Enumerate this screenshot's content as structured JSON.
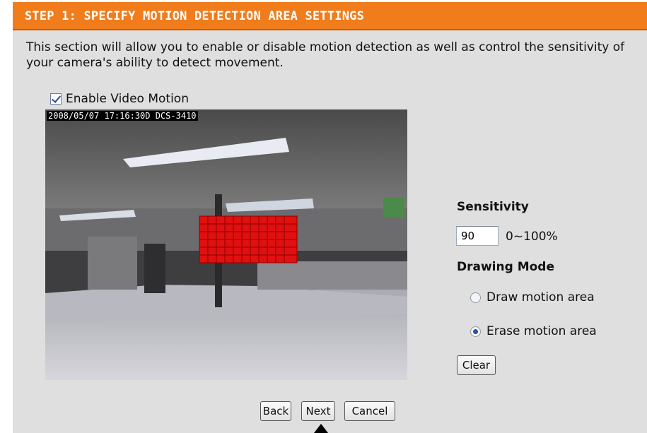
{
  "header": {
    "title": "STEP 1: SPECIFY MOTION DETECTION AREA SETTINGS"
  },
  "description": "This section will allow you to enable or disable motion detection as well as control the sensitivity of your camera's ability to detect movement.",
  "enable_video_motion": {
    "label": "Enable Video Motion",
    "checked": true
  },
  "camera": {
    "timestamp": "2008/05/07 17:16:30D DCS-3410"
  },
  "sensitivity": {
    "title": "Sensitivity",
    "value": "90",
    "range_label": "0~100%"
  },
  "drawing_mode": {
    "title": "Drawing Mode",
    "options": [
      {
        "label": "Draw motion area",
        "selected": false
      },
      {
        "label": "Erase motion area",
        "selected": true
      }
    ]
  },
  "buttons": {
    "clear": "Clear",
    "back": "Back",
    "next": "Next",
    "cancel": "Cancel"
  },
  "colors": {
    "header": "#f07c1c",
    "panel": "#dfdfdf",
    "motion_area": "#e01010"
  }
}
